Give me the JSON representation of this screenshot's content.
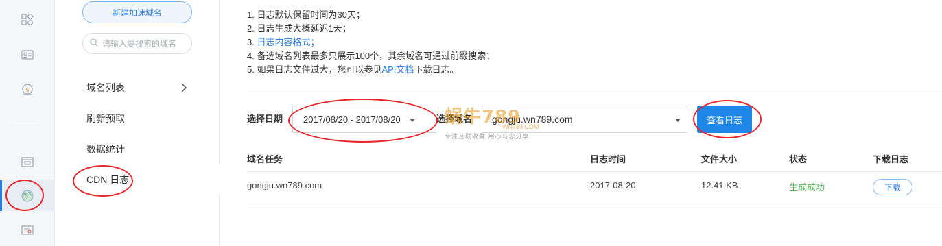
{
  "sidebar_icons": [
    "grid-icon",
    "id-card-icon",
    "coin-icon",
    "folder-icon",
    "cdn-globe-icon",
    "certificate-icon"
  ],
  "subnav": {
    "new_button": "新建加速域名",
    "search_placeholder": "请输入要搜索的域名",
    "items": [
      {
        "label": "域名列表"
      },
      {
        "label": "刷新预取"
      },
      {
        "label": "数据统计"
      },
      {
        "label": "CDN 日志"
      }
    ]
  },
  "notes": {
    "line1": "1. 日志默认保留时间为30天；",
    "line2": "2. 日志生成大概延迟1天；",
    "line3_prefix": "3. ",
    "line3_link": "日志内容格式",
    "line3_suffix": "；",
    "line4": "4. 备选域名列表最多只展示100个，其余域名可通过前缀搜索；",
    "line5_prefix": "5. 如果日志文件过大，您可以参见",
    "line5_link": "API文档",
    "line5_suffix": "下载日志。"
  },
  "filters": {
    "date_label": "选择日期",
    "date_value": "2017/08/20 - 2017/08/20",
    "domain_label": "选择域名",
    "domain_value": "gongju.wn789.com",
    "view_button": "查看日志"
  },
  "table": {
    "headers": [
      "域名任务",
      "日志时间",
      "文件大小",
      "状态",
      "下载日志"
    ],
    "rows": [
      {
        "domain": "gongju.wn789.com",
        "time": "2017-08-20",
        "size": "12.41 KB",
        "status": "生成成功",
        "action": "下载"
      }
    ]
  },
  "watermark": {
    "brand": "蜗牛789",
    "url": "WN789.COM",
    "tagline": "专注互联收藏  用心与您分享"
  },
  "colors": {
    "accent": "#1f87e8",
    "link": "#2d7de0",
    "success": "#5cb85c",
    "annotation": "#e8262b"
  }
}
